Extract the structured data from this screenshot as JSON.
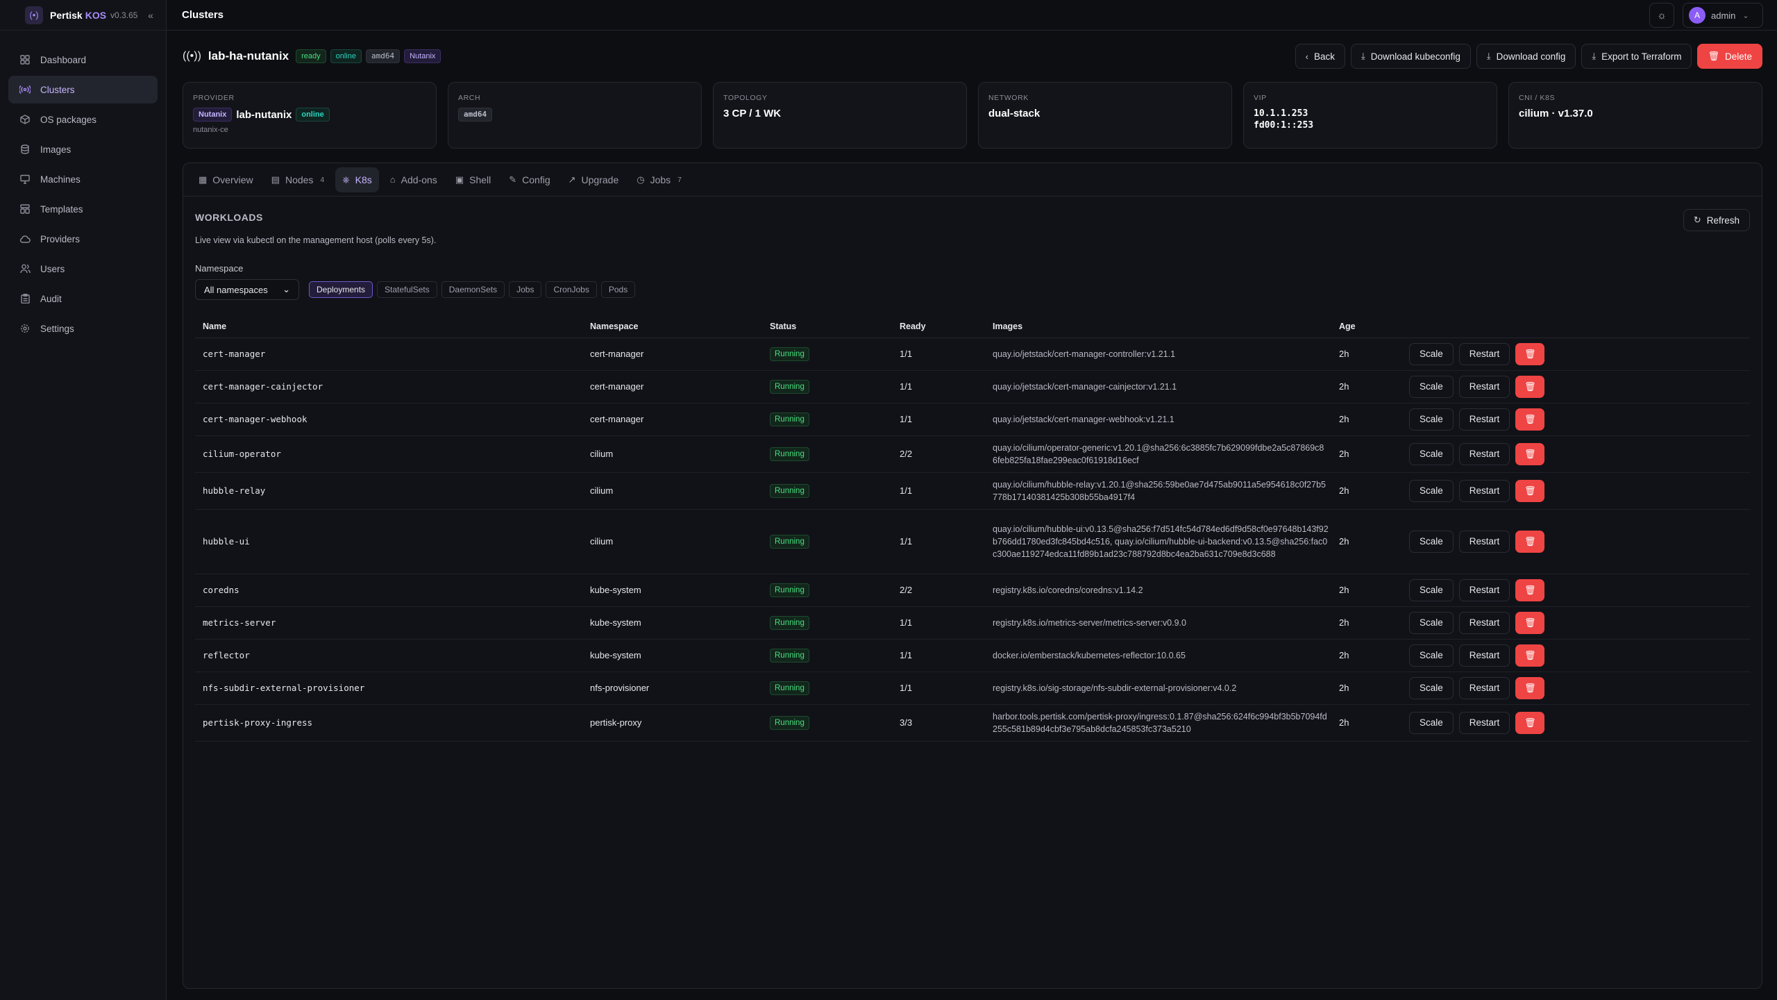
{
  "brand": {
    "name": "Pertisk",
    "kos": "KOS",
    "version": "v0.3.65"
  },
  "topbar": {
    "title": "Clusters",
    "user": "admin",
    "avatar_letter": "A"
  },
  "sidebar": {
    "items": [
      {
        "label": "Dashboard",
        "icon": "dashboard-icon"
      },
      {
        "label": "Clusters",
        "icon": "clusters-icon",
        "active": true
      },
      {
        "label": "OS packages",
        "icon": "package-icon"
      },
      {
        "label": "Images",
        "icon": "database-icon"
      },
      {
        "label": "Machines",
        "icon": "monitor-icon"
      },
      {
        "label": "Templates",
        "icon": "template-icon"
      },
      {
        "label": "Providers",
        "icon": "cloud-icon"
      },
      {
        "label": "Users",
        "icon": "users-icon"
      },
      {
        "label": "Audit",
        "icon": "clipboard-icon"
      },
      {
        "label": "Settings",
        "icon": "gear-icon"
      }
    ]
  },
  "cluster": {
    "name": "lab-ha-nutanix",
    "badges": [
      "ready",
      "online",
      "amd64",
      "Nutanix"
    ],
    "actions": {
      "back": "Back",
      "kubeconfig": "Download kubeconfig",
      "config": "Download config",
      "terraform": "Export to Terraform",
      "delete": "Delete"
    }
  },
  "cards": {
    "provider": {
      "label": "PROVIDER",
      "badge": "Nutanix",
      "name": "lab-nutanix",
      "status": "online",
      "sub": "nutanix-ce"
    },
    "arch": {
      "label": "ARCH",
      "value": "amd64"
    },
    "topology": {
      "label": "TOPOLOGY",
      "value": "3 CP / 1 WK"
    },
    "network": {
      "label": "NETWORK",
      "value": "dual-stack"
    },
    "vip": {
      "label": "VIP",
      "v4": "10.1.1.253",
      "v6": "fd00:1::253"
    },
    "cni": {
      "label": "CNI / K8S",
      "value": "cilium · v1.37.0"
    }
  },
  "tabs": [
    {
      "label": "Overview",
      "count": ""
    },
    {
      "label": "Nodes",
      "count": "4"
    },
    {
      "label": "K8s",
      "count": "",
      "active": true
    },
    {
      "label": "Add-ons",
      "count": ""
    },
    {
      "label": "Shell",
      "count": ""
    },
    {
      "label": "Config",
      "count": ""
    },
    {
      "label": "Upgrade",
      "count": ""
    },
    {
      "label": "Jobs",
      "count": "7"
    }
  ],
  "workloads": {
    "title": "WORKLOADS",
    "description": "Live view via kubectl on the management host (polls every 5s).",
    "refresh": "Refresh",
    "namespace_label": "Namespace",
    "namespace_value": "All namespaces",
    "kinds": [
      "Deployments",
      "StatefulSets",
      "DaemonSets",
      "Jobs",
      "CronJobs",
      "Pods"
    ],
    "columns": [
      "Name",
      "Namespace",
      "Status",
      "Ready",
      "Images",
      "Age",
      ""
    ],
    "scale_label": "Scale",
    "restart_label": "Restart",
    "rows": [
      {
        "name": "cert-manager",
        "ns": "cert-manager",
        "status": "Running",
        "ready": "1/1",
        "image": "quay.io/jetstack/cert-manager-controller:v1.21.1",
        "age": "2h"
      },
      {
        "name": "cert-manager-cainjector",
        "ns": "cert-manager",
        "status": "Running",
        "ready": "1/1",
        "image": "quay.io/jetstack/cert-manager-cainjector:v1.21.1",
        "age": "2h"
      },
      {
        "name": "cert-manager-webhook",
        "ns": "cert-manager",
        "status": "Running",
        "ready": "1/1",
        "image": "quay.io/jetstack/cert-manager-webhook:v1.21.1",
        "age": "2h"
      },
      {
        "name": "cilium-operator",
        "ns": "cilium",
        "status": "Running",
        "ready": "2/2",
        "image": "quay.io/cilium/operator-generic:v1.20.1@sha256:6c3885fc7b629099fdbe2a5c87869c86feb825fa18fae299eac0f61918d16ecf",
        "age": "2h"
      },
      {
        "name": "hubble-relay",
        "ns": "cilium",
        "status": "Running",
        "ready": "1/1",
        "image": "quay.io/cilium/hubble-relay:v1.20.1@sha256:59be0ae7d475ab9011a5e954618c0f27b5778b17140381425b308b55ba4917f4",
        "age": "2h"
      },
      {
        "name": "hubble-ui",
        "ns": "cilium",
        "status": "Running",
        "ready": "1/1",
        "image": "quay.io/cilium/hubble-ui:v0.13.5@sha256:f7d514fc54d784ed6df9d58cf0e97648b143f92b766dd1780ed3fc845bd4c516, quay.io/cilium/hubble-ui-backend:v0.13.5@sha256:fac0c300ae119274edca11fd89b1ad23c788792d8bc4ea2ba631c709e8d3c688",
        "age": "2h"
      },
      {
        "name": "coredns",
        "ns": "kube-system",
        "status": "Running",
        "ready": "2/2",
        "image": "registry.k8s.io/coredns/coredns:v1.14.2",
        "age": "2h"
      },
      {
        "name": "metrics-server",
        "ns": "kube-system",
        "status": "Running",
        "ready": "1/1",
        "image": "registry.k8s.io/metrics-server/metrics-server:v0.9.0",
        "age": "2h"
      },
      {
        "name": "reflector",
        "ns": "kube-system",
        "status": "Running",
        "ready": "1/1",
        "image": "docker.io/emberstack/kubernetes-reflector:10.0.65",
        "age": "2h"
      },
      {
        "name": "nfs-subdir-external-provisioner",
        "ns": "nfs-provisioner",
        "status": "Running",
        "ready": "1/1",
        "image": "registry.k8s.io/sig-storage/nfs-subdir-external-provisioner:v4.0.2",
        "age": "2h"
      },
      {
        "name": "pertisk-proxy-ingress",
        "ns": "pertisk-proxy",
        "status": "Running",
        "ready": "3/3",
        "image": "harbor.tools.pertisk.com/pertisk-proxy/ingress:0.1.87@sha256:624f6c994bf3b5b7094fd255c581b89d4cbf3e795ab8dcfa245853fc373a5210",
        "age": "2h"
      }
    ]
  }
}
